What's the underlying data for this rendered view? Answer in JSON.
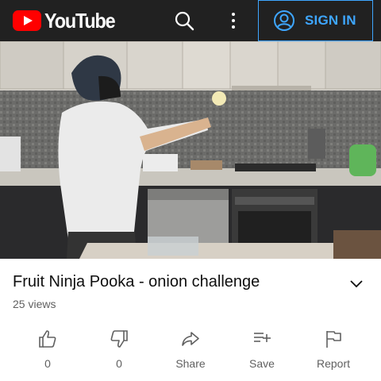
{
  "header": {
    "logo_text": "YouTube",
    "sign_in_label": "SIGN IN",
    "icons": [
      "youtube-logo",
      "search-icon",
      "more-vert-icon",
      "account-circle-icon"
    ],
    "accent": "#3ea6ff",
    "brand_red": "#ff0000",
    "background": "#212121"
  },
  "video": {
    "title": "Fruit Ninja Pooka - onion challenge",
    "views": "25 views"
  },
  "actions": [
    {
      "label": "0",
      "icon": "thumbs-up-icon"
    },
    {
      "label": "0",
      "icon": "thumbs-down-icon"
    },
    {
      "label": "Share",
      "icon": "share-icon"
    },
    {
      "label": "Save",
      "icon": "playlist-add-icon"
    },
    {
      "label": "Report",
      "icon": "flag-icon"
    }
  ]
}
